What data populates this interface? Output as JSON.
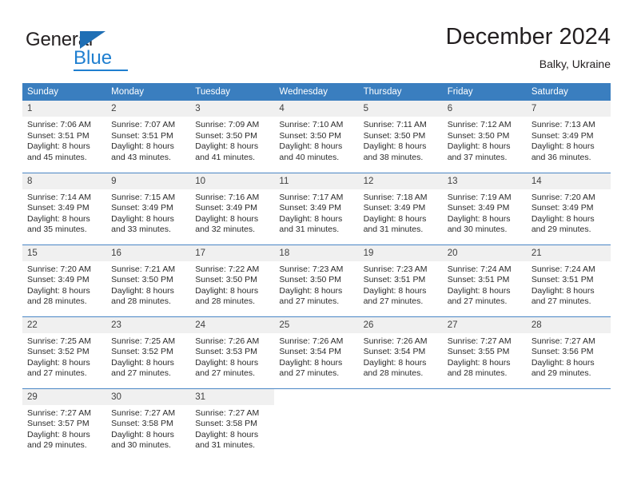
{
  "brand": {
    "name_part1": "General",
    "name_part2": "Blue",
    "triangle_color": "#1f6fb5",
    "blue_color": "#1f7fd0"
  },
  "header": {
    "title": "December 2024",
    "subtitle": "Balky, Ukraine"
  },
  "theme": {
    "header_bg": "#3a7ebf",
    "daynum_bg": "#f0f0f0",
    "grid_line": "#4a86c5"
  },
  "weekdays": [
    "Sunday",
    "Monday",
    "Tuesday",
    "Wednesday",
    "Thursday",
    "Friday",
    "Saturday"
  ],
  "labels": {
    "sunrise_prefix": "Sunrise: ",
    "sunset_prefix": "Sunset: ",
    "daylight_prefix": "Daylight: "
  },
  "weeks": [
    [
      {
        "day": "1",
        "sunrise": "Sunrise: 7:06 AM",
        "sunset": "Sunset: 3:51 PM",
        "daylight1": "Daylight: 8 hours",
        "daylight2": "and 45 minutes."
      },
      {
        "day": "2",
        "sunrise": "Sunrise: 7:07 AM",
        "sunset": "Sunset: 3:51 PM",
        "daylight1": "Daylight: 8 hours",
        "daylight2": "and 43 minutes."
      },
      {
        "day": "3",
        "sunrise": "Sunrise: 7:09 AM",
        "sunset": "Sunset: 3:50 PM",
        "daylight1": "Daylight: 8 hours",
        "daylight2": "and 41 minutes."
      },
      {
        "day": "4",
        "sunrise": "Sunrise: 7:10 AM",
        "sunset": "Sunset: 3:50 PM",
        "daylight1": "Daylight: 8 hours",
        "daylight2": "and 40 minutes."
      },
      {
        "day": "5",
        "sunrise": "Sunrise: 7:11 AM",
        "sunset": "Sunset: 3:50 PM",
        "daylight1": "Daylight: 8 hours",
        "daylight2": "and 38 minutes."
      },
      {
        "day": "6",
        "sunrise": "Sunrise: 7:12 AM",
        "sunset": "Sunset: 3:50 PM",
        "daylight1": "Daylight: 8 hours",
        "daylight2": "and 37 minutes."
      },
      {
        "day": "7",
        "sunrise": "Sunrise: 7:13 AM",
        "sunset": "Sunset: 3:49 PM",
        "daylight1": "Daylight: 8 hours",
        "daylight2": "and 36 minutes."
      }
    ],
    [
      {
        "day": "8",
        "sunrise": "Sunrise: 7:14 AM",
        "sunset": "Sunset: 3:49 PM",
        "daylight1": "Daylight: 8 hours",
        "daylight2": "and 35 minutes."
      },
      {
        "day": "9",
        "sunrise": "Sunrise: 7:15 AM",
        "sunset": "Sunset: 3:49 PM",
        "daylight1": "Daylight: 8 hours",
        "daylight2": "and 33 minutes."
      },
      {
        "day": "10",
        "sunrise": "Sunrise: 7:16 AM",
        "sunset": "Sunset: 3:49 PM",
        "daylight1": "Daylight: 8 hours",
        "daylight2": "and 32 minutes."
      },
      {
        "day": "11",
        "sunrise": "Sunrise: 7:17 AM",
        "sunset": "Sunset: 3:49 PM",
        "daylight1": "Daylight: 8 hours",
        "daylight2": "and 31 minutes."
      },
      {
        "day": "12",
        "sunrise": "Sunrise: 7:18 AM",
        "sunset": "Sunset: 3:49 PM",
        "daylight1": "Daylight: 8 hours",
        "daylight2": "and 31 minutes."
      },
      {
        "day": "13",
        "sunrise": "Sunrise: 7:19 AM",
        "sunset": "Sunset: 3:49 PM",
        "daylight1": "Daylight: 8 hours",
        "daylight2": "and 30 minutes."
      },
      {
        "day": "14",
        "sunrise": "Sunrise: 7:20 AM",
        "sunset": "Sunset: 3:49 PM",
        "daylight1": "Daylight: 8 hours",
        "daylight2": "and 29 minutes."
      }
    ],
    [
      {
        "day": "15",
        "sunrise": "Sunrise: 7:20 AM",
        "sunset": "Sunset: 3:49 PM",
        "daylight1": "Daylight: 8 hours",
        "daylight2": "and 28 minutes."
      },
      {
        "day": "16",
        "sunrise": "Sunrise: 7:21 AM",
        "sunset": "Sunset: 3:50 PM",
        "daylight1": "Daylight: 8 hours",
        "daylight2": "and 28 minutes."
      },
      {
        "day": "17",
        "sunrise": "Sunrise: 7:22 AM",
        "sunset": "Sunset: 3:50 PM",
        "daylight1": "Daylight: 8 hours",
        "daylight2": "and 28 minutes."
      },
      {
        "day": "18",
        "sunrise": "Sunrise: 7:23 AM",
        "sunset": "Sunset: 3:50 PM",
        "daylight1": "Daylight: 8 hours",
        "daylight2": "and 27 minutes."
      },
      {
        "day": "19",
        "sunrise": "Sunrise: 7:23 AM",
        "sunset": "Sunset: 3:51 PM",
        "daylight1": "Daylight: 8 hours",
        "daylight2": "and 27 minutes."
      },
      {
        "day": "20",
        "sunrise": "Sunrise: 7:24 AM",
        "sunset": "Sunset: 3:51 PM",
        "daylight1": "Daylight: 8 hours",
        "daylight2": "and 27 minutes."
      },
      {
        "day": "21",
        "sunrise": "Sunrise: 7:24 AM",
        "sunset": "Sunset: 3:51 PM",
        "daylight1": "Daylight: 8 hours",
        "daylight2": "and 27 minutes."
      }
    ],
    [
      {
        "day": "22",
        "sunrise": "Sunrise: 7:25 AM",
        "sunset": "Sunset: 3:52 PM",
        "daylight1": "Daylight: 8 hours",
        "daylight2": "and 27 minutes."
      },
      {
        "day": "23",
        "sunrise": "Sunrise: 7:25 AM",
        "sunset": "Sunset: 3:52 PM",
        "daylight1": "Daylight: 8 hours",
        "daylight2": "and 27 minutes."
      },
      {
        "day": "24",
        "sunrise": "Sunrise: 7:26 AM",
        "sunset": "Sunset: 3:53 PM",
        "daylight1": "Daylight: 8 hours",
        "daylight2": "and 27 minutes."
      },
      {
        "day": "25",
        "sunrise": "Sunrise: 7:26 AM",
        "sunset": "Sunset: 3:54 PM",
        "daylight1": "Daylight: 8 hours",
        "daylight2": "and 27 minutes."
      },
      {
        "day": "26",
        "sunrise": "Sunrise: 7:26 AM",
        "sunset": "Sunset: 3:54 PM",
        "daylight1": "Daylight: 8 hours",
        "daylight2": "and 28 minutes."
      },
      {
        "day": "27",
        "sunrise": "Sunrise: 7:27 AM",
        "sunset": "Sunset: 3:55 PM",
        "daylight1": "Daylight: 8 hours",
        "daylight2": "and 28 minutes."
      },
      {
        "day": "28",
        "sunrise": "Sunrise: 7:27 AM",
        "sunset": "Sunset: 3:56 PM",
        "daylight1": "Daylight: 8 hours",
        "daylight2": "and 29 minutes."
      }
    ],
    [
      {
        "day": "29",
        "sunrise": "Sunrise: 7:27 AM",
        "sunset": "Sunset: 3:57 PM",
        "daylight1": "Daylight: 8 hours",
        "daylight2": "and 29 minutes."
      },
      {
        "day": "30",
        "sunrise": "Sunrise: 7:27 AM",
        "sunset": "Sunset: 3:58 PM",
        "daylight1": "Daylight: 8 hours",
        "daylight2": "and 30 minutes."
      },
      {
        "day": "31",
        "sunrise": "Sunrise: 7:27 AM",
        "sunset": "Sunset: 3:58 PM",
        "daylight1": "Daylight: 8 hours",
        "daylight2": "and 31 minutes."
      },
      null,
      null,
      null,
      null
    ]
  ]
}
